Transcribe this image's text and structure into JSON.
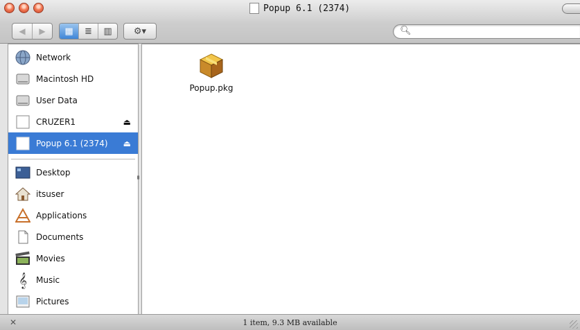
{
  "window": {
    "title": "Popup 6.1 (2374)"
  },
  "toolbar": {
    "back_glyph": "◀",
    "forward_glyph": "▶",
    "view_icon_glyph": "▦",
    "view_list_glyph": "≣",
    "view_column_glyph": "▥",
    "action_glyph": "⚙▾",
    "search_placeholder": ""
  },
  "sidebar": {
    "devices": [
      {
        "label": "Network",
        "icon": "network-globe-icon"
      },
      {
        "label": "Macintosh HD",
        "icon": "hard-disk-icon"
      },
      {
        "label": "User Data",
        "icon": "hard-disk-icon"
      },
      {
        "label": "CRUZER1",
        "icon": "removable-disk-icon",
        "eject": "⏏"
      },
      {
        "label": "Popup 6.1 (2374)",
        "icon": "disk-image-icon",
        "eject": "⏏",
        "selected": true
      }
    ],
    "places": [
      {
        "label": "Desktop",
        "icon": "desktop-icon"
      },
      {
        "label": "itsuser",
        "icon": "home-icon"
      },
      {
        "label": "Applications",
        "icon": "applications-icon"
      },
      {
        "label": "Documents",
        "icon": "documents-icon"
      },
      {
        "label": "Movies",
        "icon": "movies-icon"
      },
      {
        "label": "Music",
        "icon": "music-icon"
      },
      {
        "label": "Pictures",
        "icon": "pictures-icon"
      }
    ]
  },
  "content": {
    "files": [
      {
        "name": "Popup.pkg",
        "icon": "package-icon"
      }
    ]
  },
  "status": {
    "text": "1 item, 9.3 MB available"
  },
  "colors": {
    "selection": "#3a7bd5",
    "sidebar_bg": "#ffffff"
  }
}
